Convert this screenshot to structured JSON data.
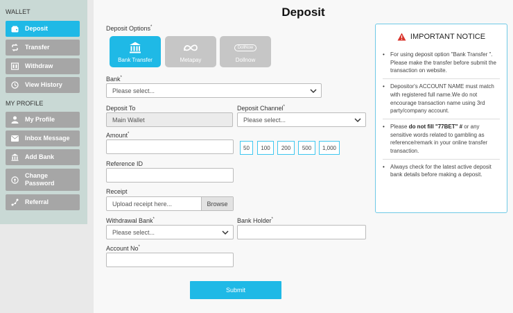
{
  "sidebar": {
    "wallet_heading": "WALLET",
    "profile_heading": "MY PROFILE",
    "wallet_items": [
      {
        "label": "Deposit",
        "icon": "wallet-icon",
        "active": true
      },
      {
        "label": "Transfer",
        "icon": "transfer-icon"
      },
      {
        "label": "Withdraw",
        "icon": "withdraw-icon"
      },
      {
        "label": "View History",
        "icon": "history-icon"
      }
    ],
    "profile_items": [
      {
        "label": "My Profile",
        "icon": "user-icon"
      },
      {
        "label": "Inbox Message",
        "icon": "envelope-icon"
      },
      {
        "label": "Add Bank",
        "icon": "bank-icon"
      },
      {
        "label": "Change Password",
        "icon": "password-icon"
      },
      {
        "label": "Referral",
        "icon": "referral-icon"
      }
    ]
  },
  "page": {
    "title": "Deposit"
  },
  "form": {
    "deposit_options_label": "Deposit Options",
    "options": [
      {
        "label": "Bank Transfer",
        "icon": "bank-icon",
        "selected": true
      },
      {
        "label": "Metapay",
        "icon": "meta-icon"
      },
      {
        "label": "Dollnow",
        "icon": "dollnow-icon",
        "logo_text": "DollNow"
      }
    ],
    "bank_label": "Bank",
    "bank_placeholder": "Please select...",
    "deposit_to_label": "Deposit To",
    "deposit_to_value": "Main Wallet",
    "deposit_channel_label": "Deposit Channel",
    "deposit_channel_placeholder": "Please select...",
    "amount_label": "Amount",
    "amount_value": "",
    "quick_amounts": [
      "50",
      "100",
      "200",
      "500",
      "1,000"
    ],
    "reference_label": "Reference ID",
    "reference_value": "",
    "receipt_label": "Receipt",
    "receipt_placeholder": "Upload receipt here...",
    "browse_label": "Browse",
    "withdrawal_bank_label": "Withdrawal Bank",
    "withdrawal_bank_placeholder": "Please select...",
    "bank_holder_label": "Bank Holder",
    "bank_holder_value": "",
    "account_no_label": "Account No",
    "account_no_value": "",
    "submit_label": "Submit",
    "required_mark": "*"
  },
  "notice": {
    "title": "IMPORTANT NOTICE",
    "icon": "warning-icon",
    "items": [
      {
        "text": "For using deposit option \"Bank Transfer \". Please make the transfer before submit the transaction on website."
      },
      {
        "text": "Depositor's ACCOUNT NAME must match with registered full name.We do not encourage transaction name using 3rd party/company account."
      },
      {
        "pre": "Please ",
        "bold": "do not fill \"77BET\" #",
        "post": " or any sensitive words related to gambling as reference/remark in your online transfer transaction."
      },
      {
        "text": "Always check for the latest active deposit bank details before making a deposit."
      }
    ]
  },
  "colors": {
    "accent": "#1fb9e6",
    "sidebar_bg": "#c9d9d5",
    "nav_item": "#a6a6a6",
    "warning": "#d9342b"
  }
}
